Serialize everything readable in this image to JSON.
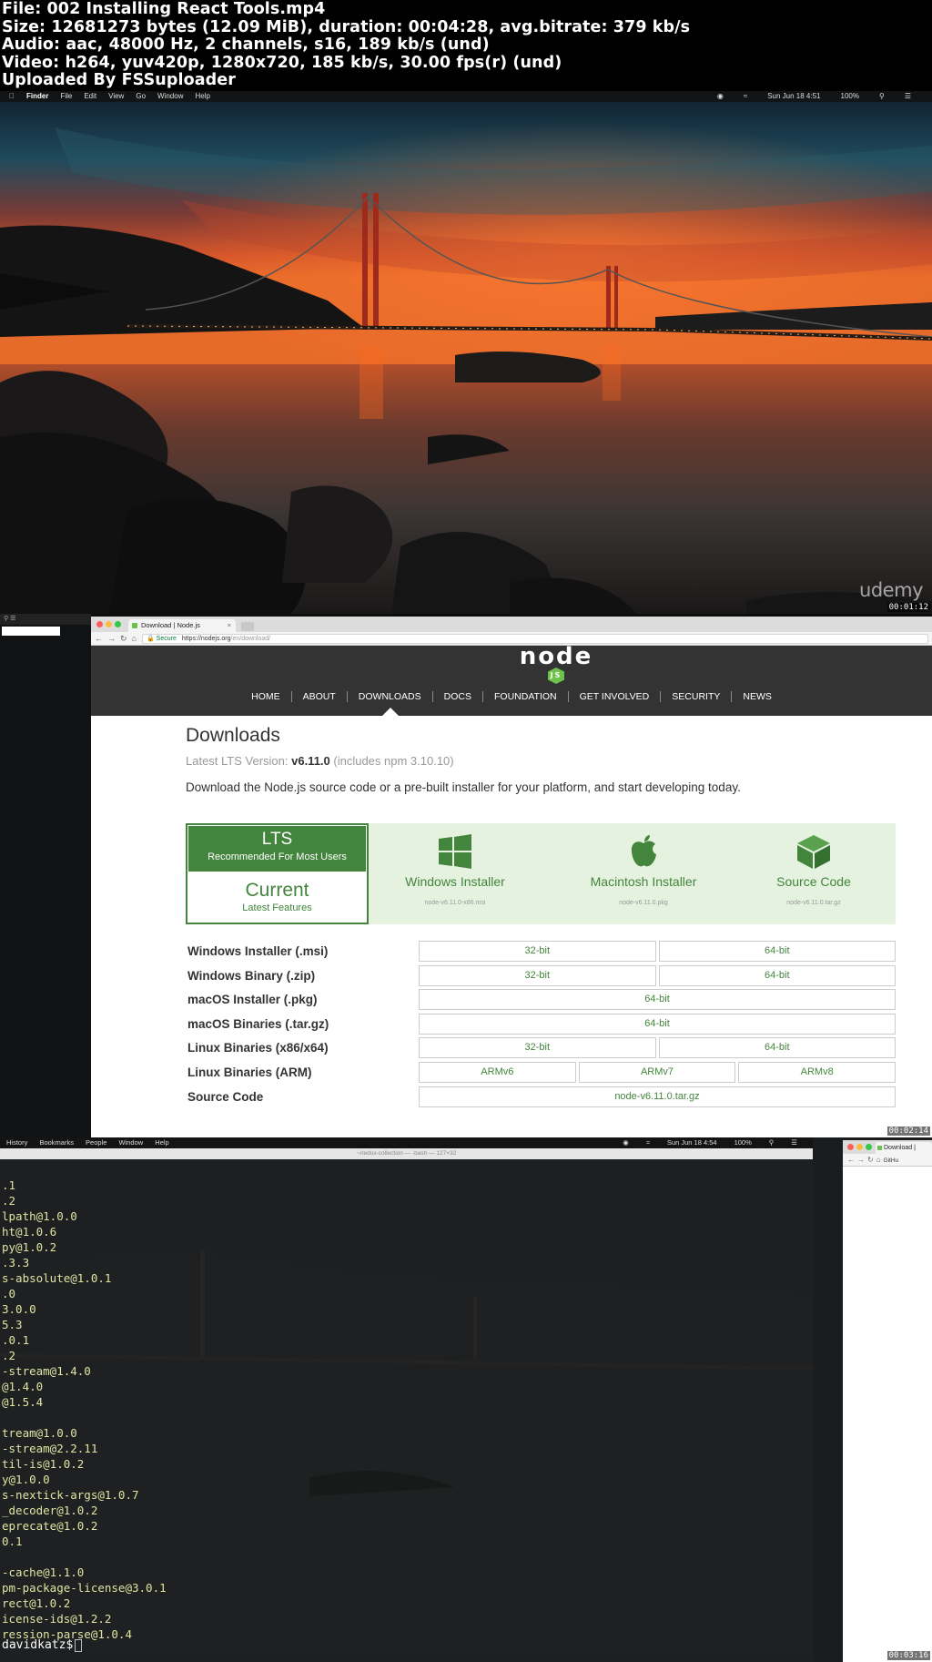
{
  "meta": {
    "lines": [
      "File: 002 Installing React Tools.mp4",
      "Size: 12681273 bytes (12.09 MiB), duration: 00:04:28, avg.bitrate: 379 kb/s",
      "Audio: aac, 48000 Hz, 2 channels, s16, 189 kb/s (und)",
      "Video: h264, yuv420p, 1280x720, 185 kb/s, 30.00 fps(r) (und)",
      "Uploaded By FSSuploader"
    ]
  },
  "frame1": {
    "menubar": {
      "items": [
        "Finder",
        "File",
        "Edit",
        "View",
        "Go",
        "Window",
        "Help"
      ],
      "clock": "Sun Jun 18 4:51",
      "battery": "100%"
    },
    "watermark": "udemy",
    "timestamp": "00:01:12"
  },
  "frame2": {
    "tab_title": "Download | Node.js",
    "tab_close": "×",
    "url_secure": "Secure",
    "url_host": "https://nodejs.org",
    "url_path": "/en/download/",
    "logo_text": "node",
    "logo_badge": "JS",
    "nav": [
      "HOME",
      "ABOUT",
      "DOWNLOADS",
      "DOCS",
      "FOUNDATION",
      "GET INVOLVED",
      "SECURITY",
      "NEWS"
    ],
    "heading": "Downloads",
    "lts_prefix": "Latest LTS Version: ",
    "lts_version": "v6.11.0",
    "lts_suffix": " (includes npm 3.10.10)",
    "intro": "Download the Node.js source code or a pre-built installer for your platform, and start developing today.",
    "lts_box": {
      "title": "LTS",
      "subtitle": "Recommended For Most Users",
      "current": "Current",
      "current_sub": "Latest Features"
    },
    "installers": [
      {
        "name": "Windows Installer",
        "file": "node-v6.11.0-x86.msi",
        "icon": "windows-icon"
      },
      {
        "name": "Macintosh Installer",
        "file": "node-v6.11.0.pkg",
        "icon": "apple-icon"
      },
      {
        "name": "Source Code",
        "file": "node-v6.11.0.tar.gz",
        "icon": "cube-icon"
      }
    ],
    "rows": [
      {
        "label": "Windows Installer (.msi)",
        "cells": [
          "32-bit",
          "64-bit"
        ]
      },
      {
        "label": "Windows Binary (.zip)",
        "cells": [
          "32-bit",
          "64-bit"
        ]
      },
      {
        "label": "macOS Installer (.pkg)",
        "cells": [
          "64-bit"
        ]
      },
      {
        "label": "macOS Binaries (.tar.gz)",
        "cells": [
          "64-bit"
        ]
      },
      {
        "label": "Linux Binaries (x86/x64)",
        "cells": [
          "32-bit",
          "64-bit"
        ]
      },
      {
        "label": "Linux Binaries (ARM)",
        "cells": [
          "ARMv6",
          "ARMv7",
          "ARMv8"
        ]
      },
      {
        "label": "Source Code",
        "cells": [
          "node-v6.11.0.tar.gz"
        ]
      }
    ],
    "timestamp": "00:02:14",
    "colors": {
      "node_green": "#43853d",
      "header_bg": "#333333"
    }
  },
  "frame3": {
    "menubar": {
      "items": [
        "History",
        "Bookmarks",
        "People",
        "Window",
        "Help"
      ],
      "clock": "Sun Jun 18 4:54",
      "battery": "100%"
    },
    "title": "~/redux-collection — -bash — 127×32",
    "lines": [
      ".1",
      ".2",
      "lpath@1.0.0",
      "ht@1.0.6",
      "py@1.0.2",
      ".3.3",
      "s-absolute@1.0.1",
      ".0",
      "3.0.0",
      "5.3",
      ".0.1",
      ".2",
      "-stream@1.4.0",
      "@1.4.0",
      "@1.5.4",
      "",
      "tream@1.0.0",
      "-stream@2.2.11",
      "til-is@1.0.2",
      "y@1.0.0",
      "s-nextick-args@1.0.7",
      "_decoder@1.0.2",
      "eprecate@1.0.2",
      "0.1",
      "",
      "-cache@1.1.0",
      "pm-package-license@3.0.1",
      "rect@1.0.2",
      "icense-ids@1.2.2",
      "ression-parse@1.0.4"
    ],
    "prompt": "davidkatz$",
    "side_tab": "Download | ",
    "side_url": "GitHu",
    "timestamp": "00:03:16"
  }
}
